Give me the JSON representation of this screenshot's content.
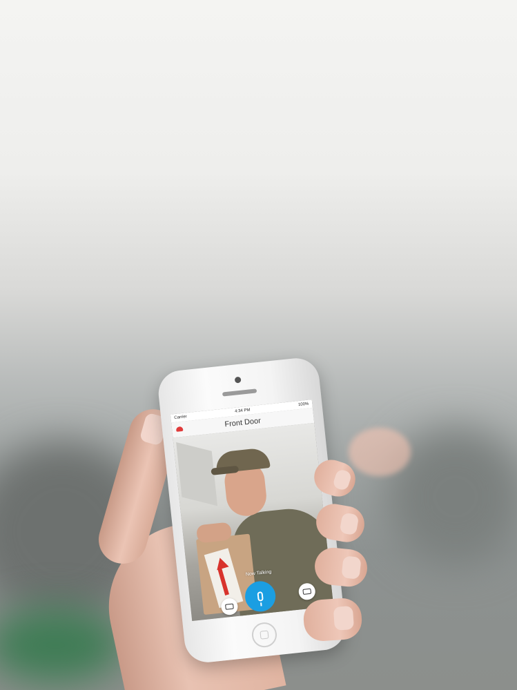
{
  "status_bar": {
    "carrier": "Carrier",
    "time": "4:34 PM",
    "battery": "100%"
  },
  "nav": {
    "title": "Front Door"
  },
  "video_overlay": {
    "talking_label": "Now Talking"
  },
  "icons": {
    "hangup": "phone-hangup-icon",
    "mic": "microphone-icon",
    "record": "video-record-icon",
    "snapshot": "camera-snapshot-icon"
  },
  "colors": {
    "accent": "#1b9ee2",
    "hangup": "#e03b3b"
  }
}
